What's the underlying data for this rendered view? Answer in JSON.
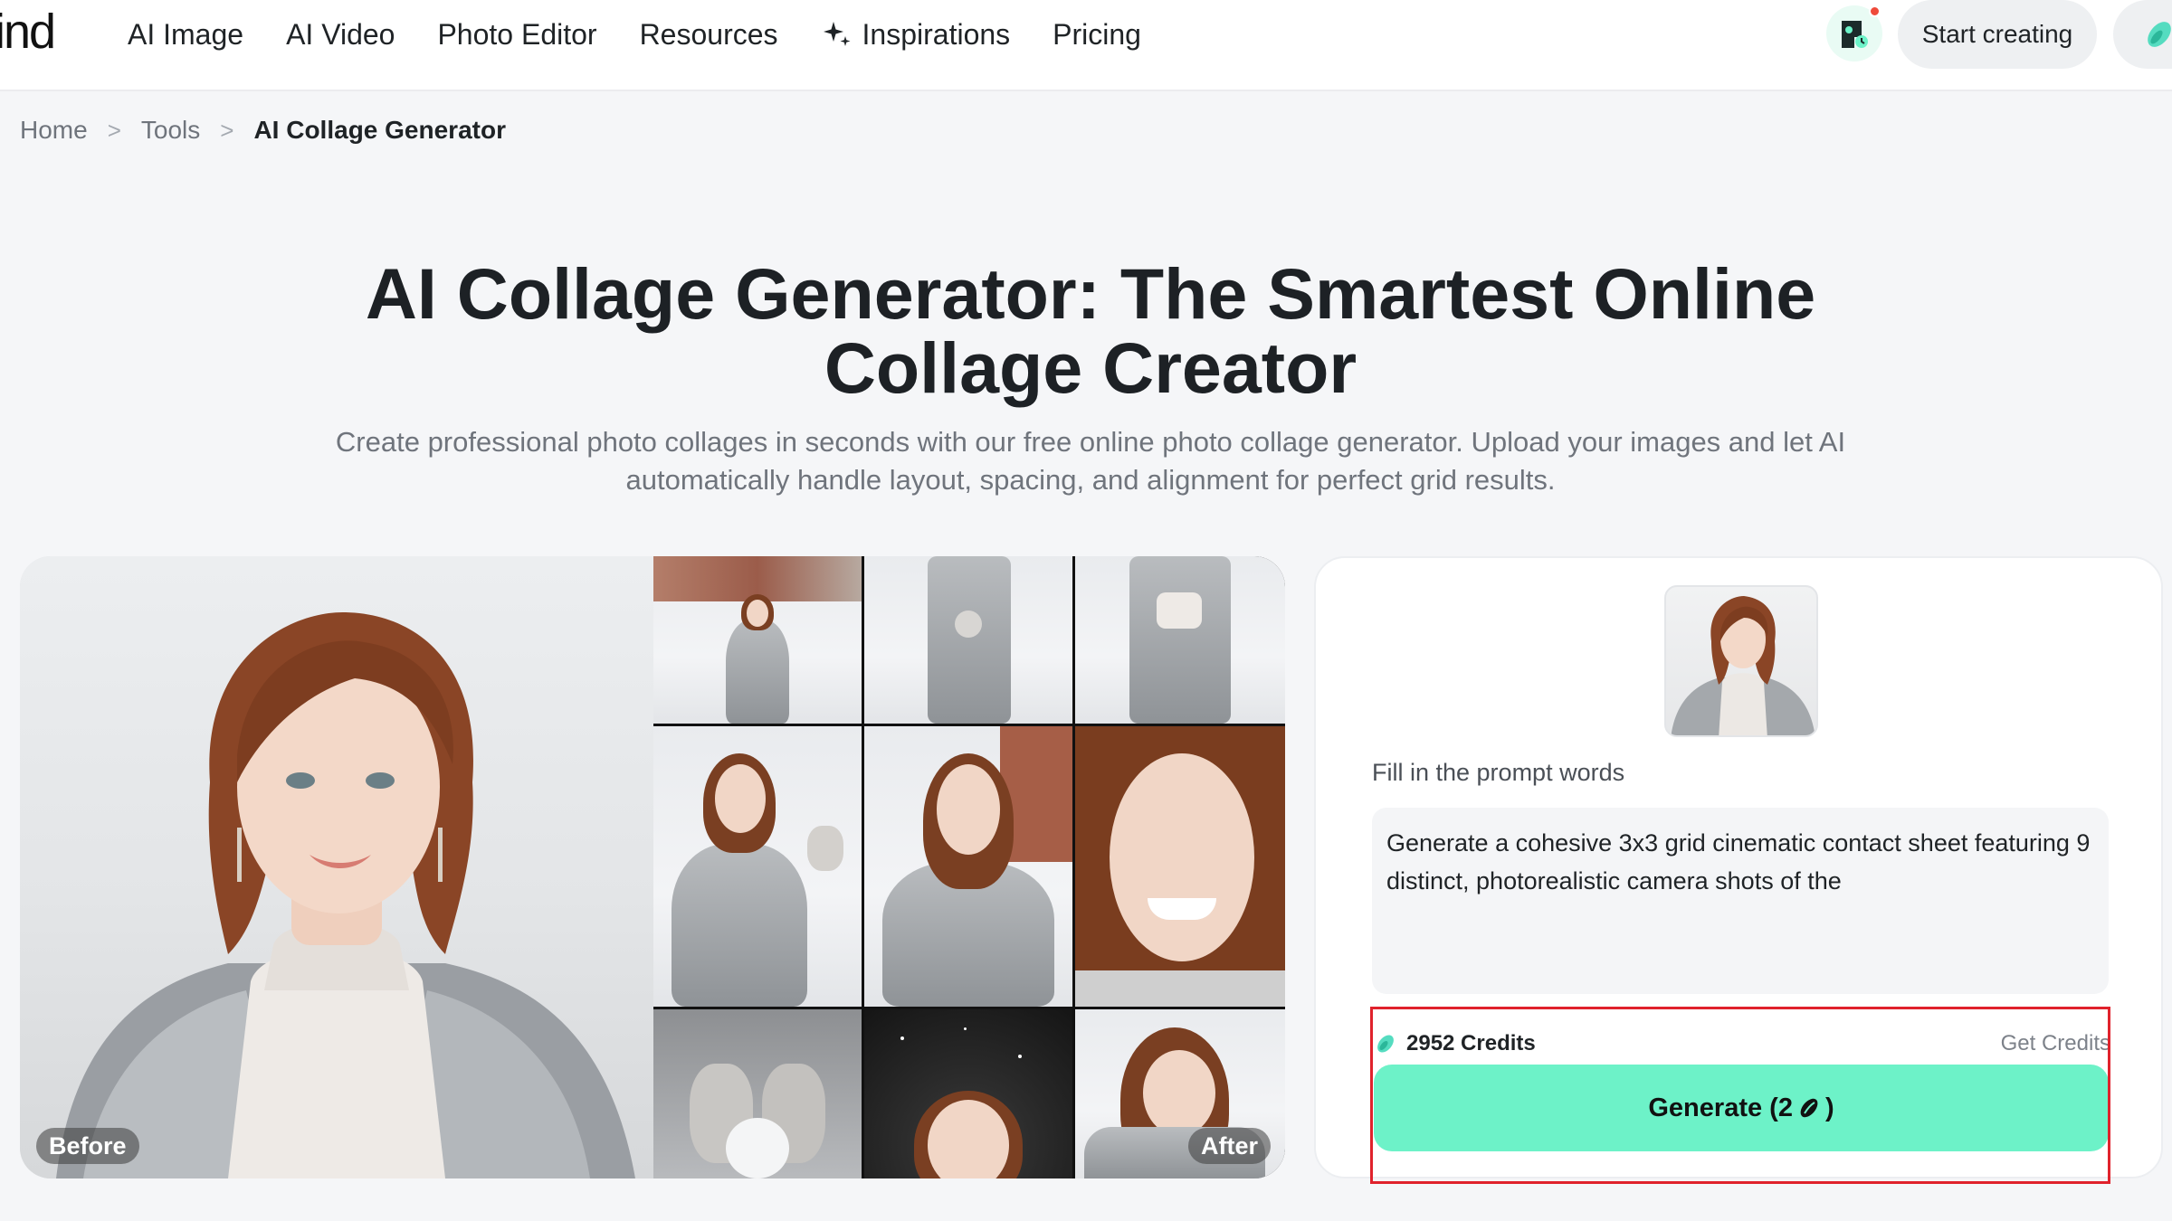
{
  "header": {
    "logo_text": "ind",
    "nav": [
      {
        "label": "AI Image"
      },
      {
        "label": "AI Video"
      },
      {
        "label": "Photo Editor"
      },
      {
        "label": "Resources"
      },
      {
        "label": "Inspirations",
        "icon": "sparkle-icon"
      },
      {
        "label": "Pricing"
      }
    ],
    "start_label": "Start creating",
    "notification_color": "#ef4a3a"
  },
  "breadcrumb": {
    "items": [
      "Home",
      "Tools"
    ],
    "current": "AI Collage Generator",
    "separator": ">"
  },
  "hero": {
    "title_line1": "AI Collage Generator: The Smartest Online",
    "title_line2": "Collage Creator",
    "subtitle_line1": "Create professional photo collages in seconds with our free online photo collage generator. Upload your images and let AI",
    "subtitle_line2": "automatically handle layout, spacing, and alignment for perfect grid results."
  },
  "compare": {
    "before_label": "Before",
    "after_label": "After"
  },
  "generator": {
    "prompt_label": "Fill in the prompt words",
    "prompt_value": "Generate a cohesive 3x3 grid cinematic contact sheet featuring 9 distinct, photorealistic camera shots of the",
    "credits_text": "2952 Credits",
    "get_credits_label": "Get Credits",
    "generate_label": "Generate (2",
    "generate_suffix": ")",
    "accent_color": "#6df2c8",
    "highlight_color": "#e0222c"
  }
}
